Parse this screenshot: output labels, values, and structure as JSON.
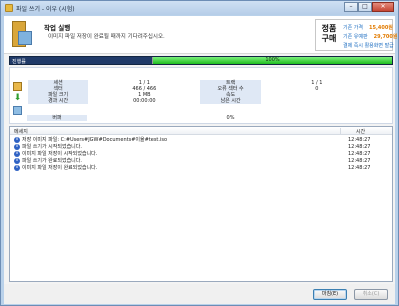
{
  "window": {
    "title": "파일 쓰기 - 이우 (시험)",
    "controls": {
      "minimize": "–",
      "maximize": "□",
      "close": "✕"
    }
  },
  "header": {
    "title": "작업 실행",
    "description": "이미지 파일 저장이 완료될 때까지 기다려주십시오.",
    "icon": "folder-image-icon"
  },
  "promo": {
    "big_line1": "정품",
    "big_line2": "구매",
    "line1_label": "기존 가격",
    "line1_value": "15,400원",
    "line2_label": "기존 유예판",
    "line2_value": "29,700원",
    "line3": "결제 즉시 활용화면 발급"
  },
  "progress": {
    "label": "진행률",
    "percent_text": "100%",
    "percent": 100
  },
  "stats": {
    "rows": [
      {
        "k1": "세션",
        "v1": "1 / 1",
        "k2": "트랙",
        "v2": "1 / 1"
      },
      {
        "k1": "섹터",
        "v1": "466 / 466",
        "k2": "오류 섹터 수",
        "v2": "0"
      },
      {
        "k1": "파일 크기",
        "v1": "1 MB",
        "k2": "속도",
        "v2": ""
      },
      {
        "k1": "경과 시간",
        "v1": "00:00:00",
        "k2": "남은 시간",
        "v2": ""
      }
    ],
    "recv_label": "버퍼",
    "recv_value": "0%"
  },
  "log": {
    "col_message": "메세지",
    "col_time": "시간",
    "entries": [
      {
        "msg": "저장 이미지 파일: C:#Users#JGW#Documents#이율#test.iso",
        "time": "12:48:27"
      },
      {
        "msg": "파일 쓰기가 시작되었습니다.",
        "time": "12:48:27"
      },
      {
        "msg": "이미지 파일 저장이 시작되었습니다.",
        "time": "12:48:27"
      },
      {
        "msg": "파일 쓰기가 완료되었습니다.",
        "time": "12:48:27"
      },
      {
        "msg": "이미지 파일 저장이 완료되었습니다.",
        "time": "12:48:27"
      }
    ]
  },
  "footer": {
    "confirm": "마침(E)",
    "cancel": "취소(C)"
  }
}
